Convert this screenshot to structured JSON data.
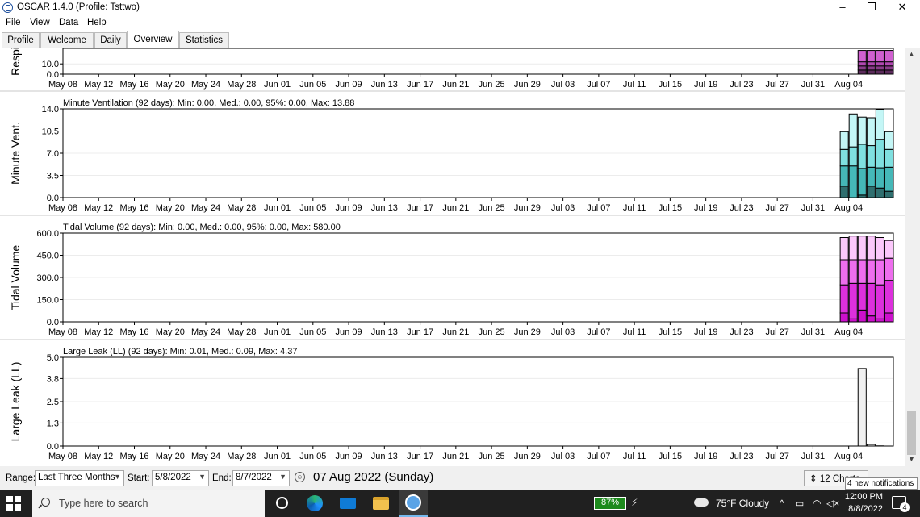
{
  "window": {
    "title": "OSCAR 1.4.0 (Profile: Tsttwo)",
    "minimize": "–",
    "restore": "❐",
    "close": "✕"
  },
  "menu": [
    "File",
    "View",
    "Data",
    "Help"
  ],
  "tabs": [
    {
      "label": "Profile",
      "active": false
    },
    {
      "label": "Welcome",
      "active": false
    },
    {
      "label": "Daily",
      "active": false
    },
    {
      "label": "Overview",
      "active": true
    },
    {
      "label": "Statistics",
      "active": false
    }
  ],
  "chart_data": [
    {
      "type": "bar",
      "stacked": true,
      "ylabel": "Respi",
      "header": "",
      "yticks": [
        "0.0",
        "10.0"
      ],
      "ylim": [
        0,
        25
      ],
      "colors": [
        "#5c2b5c",
        "#8a3c8a",
        "#b048b0",
        "#d060d0"
      ],
      "x": [
        "Aug 05",
        "Aug 06",
        "Aug 07",
        "Aug 08"
      ],
      "series": [
        {
          "values": [
            4,
            4,
            4,
            4
          ]
        },
        {
          "values": [
            4,
            4,
            4,
            4
          ]
        },
        {
          "values": [
            4,
            4,
            4,
            4
          ]
        },
        {
          "values": [
            11,
            11,
            11,
            11
          ]
        }
      ]
    },
    {
      "type": "bar",
      "stacked": true,
      "ylabel": "Minute Vent.",
      "header": "Minute Ventilation (92 days):  Min: 0.00, Med.: 0.00, 95%: 0.00, Max: 13.88",
      "yticks": [
        "0.0",
        "3.5",
        "7.0",
        "10.5",
        "14.0"
      ],
      "ylim": [
        0,
        14
      ],
      "colors": [
        "#2f6f6f",
        "#45b8b8",
        "#7fe0e0",
        "#c4f6f6"
      ],
      "x": [
        "Aug 03",
        "Aug 04",
        "Aug 05",
        "Aug 06",
        "Aug 07",
        "Aug 08"
      ],
      "series": [
        {
          "values": [
            1.8,
            0.0,
            0.4,
            1.8,
            1.5,
            1.0
          ]
        },
        {
          "values": [
            3.2,
            5.0,
            4.2,
            3.0,
            3.2,
            3.8
          ]
        },
        {
          "values": [
            2.6,
            3.0,
            3.8,
            3.4,
            4.5,
            2.8
          ]
        },
        {
          "values": [
            2.8,
            5.2,
            4.3,
            4.4,
            4.7,
            2.8
          ]
        }
      ]
    },
    {
      "type": "bar",
      "stacked": true,
      "ylabel": "Tidal Volume",
      "header": "Tidal Volume (92 days):  Min: 0.00, Med.: 0.00, 95%: 0.00, Max: 580.00",
      "yticks": [
        "0.0",
        "150.0",
        "300.0",
        "450.0",
        "600.0"
      ],
      "ylim": [
        0,
        600
      ],
      "colors": [
        "#cc10cc",
        "#dd30dd",
        "#ee6eee",
        "#fbc8fb"
      ],
      "x": [
        "Aug 03",
        "Aug 04",
        "Aug 05",
        "Aug 06",
        "Aug 07",
        "Aug 08"
      ],
      "series": [
        {
          "values": [
            60,
            20,
            80,
            40,
            20,
            60
          ]
        },
        {
          "values": [
            190,
            240,
            180,
            220,
            230,
            220
          ]
        },
        {
          "values": [
            170,
            160,
            160,
            160,
            170,
            150
          ]
        },
        {
          "values": [
            150,
            160,
            160,
            160,
            150,
            120
          ]
        }
      ]
    },
    {
      "type": "bar",
      "stacked": false,
      "ylabel": "Large Leak (LL)",
      "header": "Large Leak (LL) (92 days):  Min: 0.01, Med.: 0.09, Max: 4.37",
      "yticks": [
        "0.0",
        "1.3",
        "2.5",
        "3.8",
        "5.0"
      ],
      "ylim": [
        0,
        5
      ],
      "colors": [
        "#f0f0f0"
      ],
      "x": [
        "Aug 05",
        "Aug 06",
        "Aug 07"
      ],
      "series": [
        {
          "values": [
            4.37,
            0.09,
            0.01
          ]
        }
      ]
    }
  ],
  "xaxis": {
    "start": "2022-05-08",
    "end": "2022-08-08",
    "ticks": [
      "May 08",
      "May 12",
      "May 16",
      "May 20",
      "May 24",
      "May 28",
      "Jun 01",
      "Jun 05",
      "Jun 09",
      "Jun 13",
      "Jun 17",
      "Jun 21",
      "Jun 25",
      "Jun 29",
      "Jul 03",
      "Jul 07",
      "Jul 11",
      "Jul 15",
      "Jul 19",
      "Jul 23",
      "Jul 27",
      "Jul 31",
      "Aug 04"
    ]
  },
  "bottom": {
    "range_label": "Range:",
    "range_value": "Last Three Months",
    "start_label": "Start:",
    "start_value": "5/8/2022",
    "end_label": "End:",
    "end_value": "8/7/2022",
    "current_date": "07 Aug 2022 (Sunday)",
    "charts_button": "12 Charts",
    "notification_tip": "4 new notifications"
  },
  "taskbar": {
    "search_placeholder": "Type here to search",
    "battery": "87%",
    "weather": "75°F  Cloudy",
    "time": "12:00 PM",
    "date": "8/8/2022",
    "notifications_count": "4"
  }
}
